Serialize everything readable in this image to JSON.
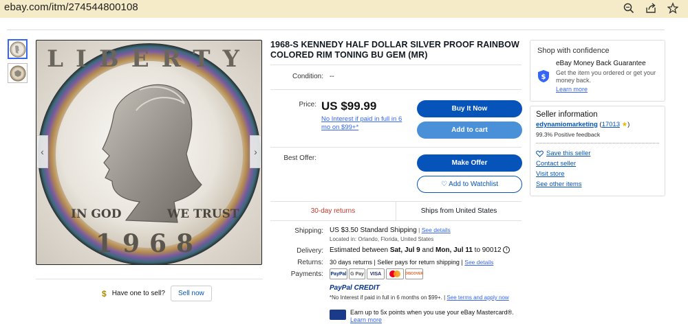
{
  "browser": {
    "url": "ebay.com/itm/274544800108",
    "icons": [
      "zoom-icon",
      "share-icon",
      "star-icon"
    ]
  },
  "gallery": {
    "coin_year_text": "1968",
    "coin_left_text": "IN GOD",
    "coin_right_text": "WE TRUST",
    "coin_top_text": "LIBERTY"
  },
  "sell": {
    "prompt": "Have one to sell?",
    "button": "Sell now"
  },
  "item": {
    "title": "1968-S KENNEDY HALF DOLLAR SILVER PROOF RAINBOW COLORED RIM TONING BU GEM (MR)",
    "condition_label": "Condition:",
    "condition_value": "--",
    "price_label": "Price:",
    "price": "US $99.99",
    "interest_text": "No Interest if paid in full in 6 mo on $99+*",
    "best_offer_label": "Best Offer:",
    "buy_now": "Buy It Now",
    "add_to_cart": "Add to cart",
    "make_offer": "Make Offer",
    "watchlist": "♡ Add to Watchlist",
    "returns_summary": "30-day returns",
    "ships_from": "Ships from United States",
    "shipping_label": "Shipping:",
    "shipping_value": "US $3.50 Standard Shipping",
    "shipping_sep": " | ",
    "shipping_link": "See details",
    "located": "Located in: Orlando, Florida, United States",
    "delivery_label": "Delivery:",
    "delivery_pre": "Estimated between ",
    "delivery_d1": "Sat, Jul 9",
    "delivery_mid": " and ",
    "delivery_d2": "Mon, Jul 11",
    "delivery_post": " to 90012",
    "returns_label": "Returns:",
    "returns_value": "30 days returns | Seller pays for return shipping | ",
    "returns_link": "See details",
    "payments_label": "Payments:",
    "payment_methods": [
      "PayPal",
      "G Pay",
      "VISA",
      "MC",
      "DISCOVER"
    ],
    "paypal_credit": "PayPal CREDIT",
    "credit_note": "*No Interest if paid in full in 6 months on $99+. | ",
    "credit_link": "See terms and apply now",
    "mastercard_text": "Earn up to 5x points when you use your eBay Mastercard®.",
    "learn_more": "Learn more"
  },
  "confidence": {
    "title": "Shop with confidence",
    "guarantee": "eBay Money Back Guarantee",
    "guarantee_sub": "Get the item you ordered or get your money back.",
    "learn_more": "Learn more"
  },
  "seller": {
    "title": "Seller information",
    "name": "edynamiomarketing",
    "open_paren": " (",
    "score": "17013",
    "star": " ★",
    "close_paren": ")",
    "feedback": "99.3% Positive feedback",
    "save": "Save this seller",
    "contact": "Contact seller",
    "visit": "Visit store",
    "other": "See other items"
  },
  "colors": {
    "accent": "#0654ba",
    "accent_light": "#4a90d8",
    "topbar": "#f6ebc8",
    "returns_red": "#c0392b"
  }
}
